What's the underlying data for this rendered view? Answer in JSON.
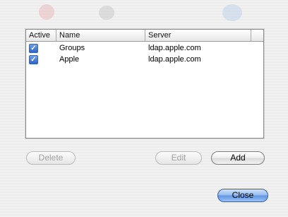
{
  "table": {
    "columns": {
      "active": "Active",
      "name": "Name",
      "server": "Server"
    },
    "rows": [
      {
        "active": true,
        "name": "Groups",
        "server": "ldap.apple.com"
      },
      {
        "active": true,
        "name": "Apple",
        "server": "ldap.apple.com"
      }
    ]
  },
  "buttons": {
    "delete": "Delete",
    "edit": "Edit",
    "add": "Add",
    "close": "Close"
  },
  "icons": {
    "checkbox": "checkmark"
  },
  "colors": {
    "accent": "#5e93e3",
    "checkbox": "#2d63c6"
  }
}
